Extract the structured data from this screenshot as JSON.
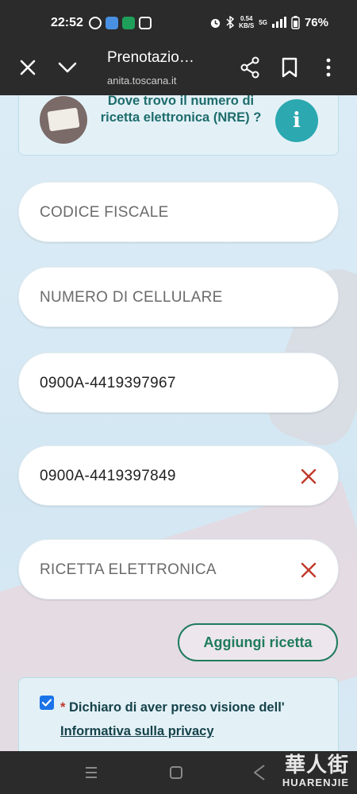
{
  "status_bar": {
    "time": "22:52",
    "net_speed_value": "0.54",
    "net_speed_unit": "KB/S",
    "network": "5G",
    "battery": "76%"
  },
  "browser": {
    "title": "Prenotazio…",
    "url": "anita.toscana.it"
  },
  "nre_card": {
    "text": "Dove trovo il numero di ricetta elettronica (NRE) ?",
    "info_glyph": "i"
  },
  "fields": [
    {
      "placeholder": "CODICE FISCALE",
      "value": ""
    },
    {
      "placeholder": "NUMERO DI CELLULARE",
      "value": ""
    },
    {
      "placeholder": "",
      "value": "0900A-4419397967"
    },
    {
      "placeholder": "",
      "value": "0900A-4419397849"
    },
    {
      "placeholder": "RICETTA ELETTRONICA",
      "value": ""
    }
  ],
  "add_button_label": "Aggiungi ricetta",
  "privacy": {
    "required_mark": "*",
    "text": "Dichiaro di aver preso visione dell'",
    "link": "Informativa sulla privacy",
    "checked": true
  },
  "watermark": {
    "chinese": "華人街",
    "latin": "HUARENJIE"
  },
  "colors": {
    "accent_green": "#1f7b5b",
    "teal_text": "#1d6c6c",
    "info_button": "#2ba8b0",
    "clear_icon": "#c0392b",
    "checkbox": "#1a73e8"
  }
}
